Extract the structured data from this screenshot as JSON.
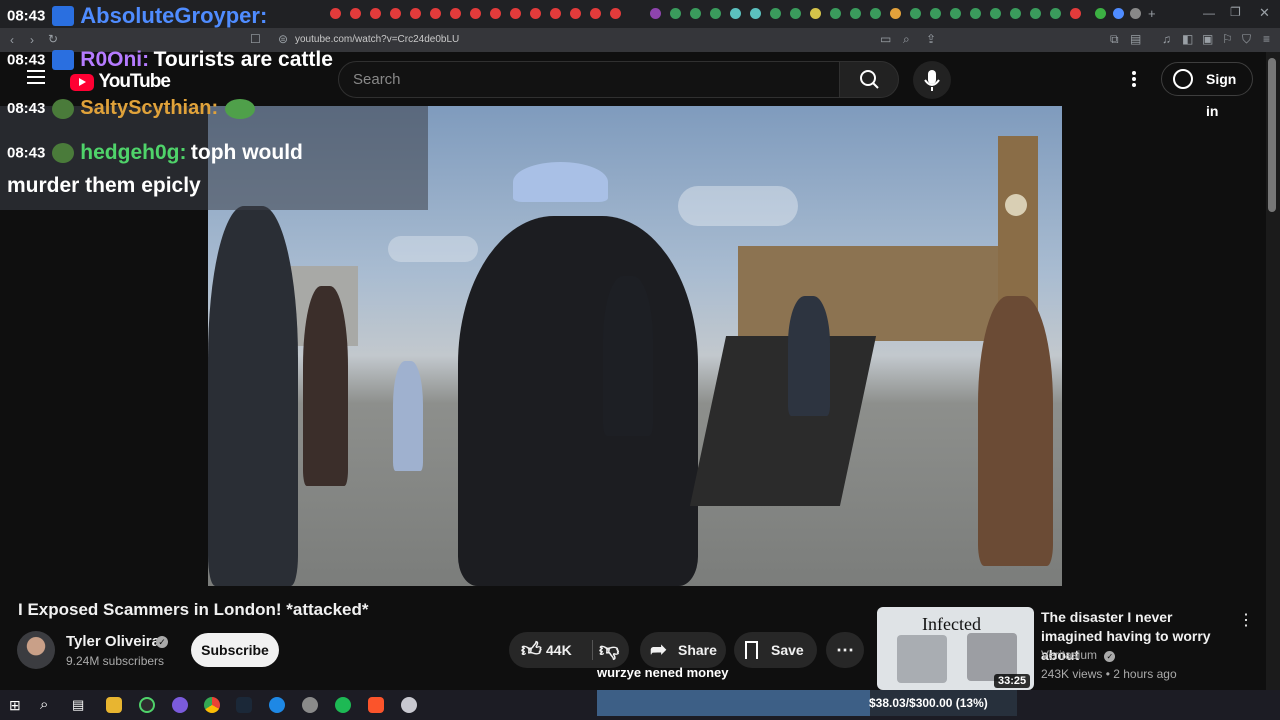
{
  "browser": {
    "url": "youtube.com/watch?v=Crc24de0bLU"
  },
  "youtube": {
    "logo_text": "YouTube",
    "search_placeholder": "Search",
    "sign_in_label": "Sign in"
  },
  "chat": [
    {
      "time": "08:43",
      "user": "AbsoluteGroyper:",
      "message": "",
      "color": "#4f8cff"
    },
    {
      "time": "08:43",
      "user": "R0Oni:",
      "message": "Tourists are cattle",
      "color": "#b57bff"
    },
    {
      "time": "08:43",
      "user": "SaltyScythian:",
      "message": "",
      "color": "#e0a23a"
    },
    {
      "time": "08:43",
      "user": "hedgeh0g:",
      "message": "toph would",
      "color": "#4fd36a"
    },
    {
      "message_continued": "murder them epicly"
    }
  ],
  "video": {
    "title": "I Exposed Scammers in London! *attacked*",
    "channel": "Tyler Oliveira",
    "subscribers": "9.24M subscribers",
    "subscribe_label": "Subscribe",
    "likes": "44K",
    "share_label": "Share",
    "save_label": "Save"
  },
  "stream_overlay": {
    "caption": "wurzye nened money",
    "goal_text": "$38.03/$300.00 (13%)",
    "goal_progress": 0.13
  },
  "recommendation": {
    "thumbnail_text": "Infected",
    "duration": "33:25",
    "title": "The disaster I never imagined having to worry about",
    "channel": "Veritasium",
    "meta": "243K views • 2 hours ago"
  }
}
